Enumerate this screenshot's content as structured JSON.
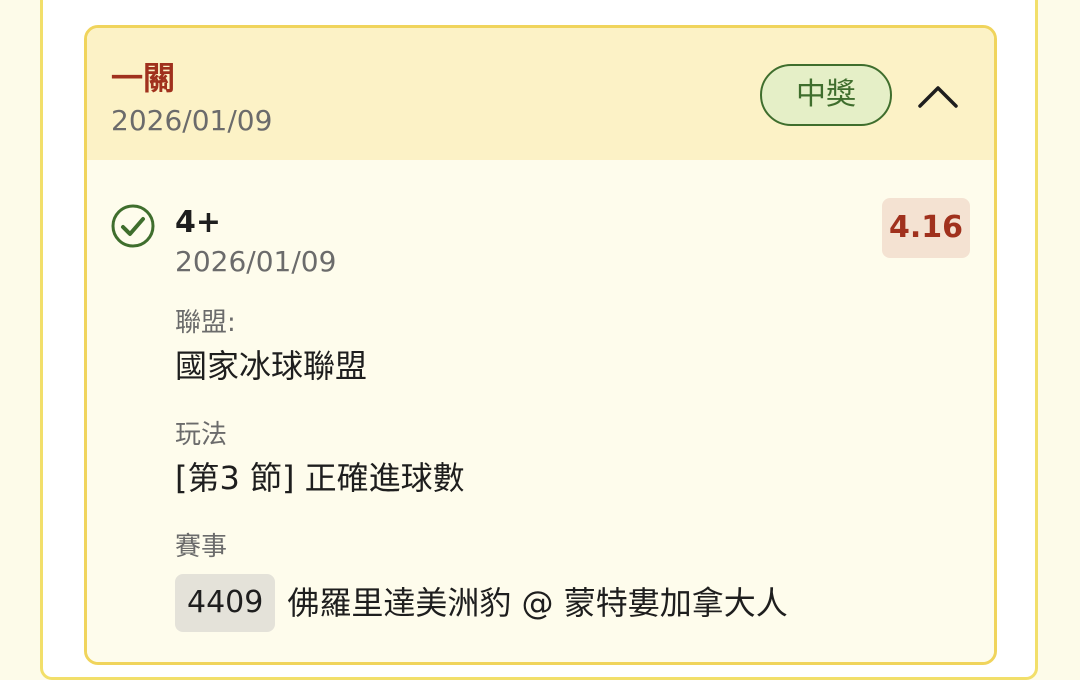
{
  "header": {
    "bet_type": "一關",
    "date": "2026/01/09",
    "status": "中獎",
    "toggle_icon": "chevron-up-icon"
  },
  "selection": {
    "name": "4+",
    "date": "2026/01/09",
    "odds": "4.16",
    "icon": "check-circle-icon"
  },
  "fields": {
    "league_label": "聯盟:",
    "league_value": "國家冰球聯盟",
    "market_label": "玩法",
    "market_value": "[第3 節] 正確進球數",
    "event_label": "賽事",
    "event_id": "4409",
    "event_teams": "佛羅里達美洲豹 @ 蒙特婁加拿大人"
  },
  "colors": {
    "accent_red": "#a0311d",
    "win_green": "#3f6e2d",
    "header_bg": "#fcf2c6",
    "border_yellow": "#f0d45c"
  }
}
